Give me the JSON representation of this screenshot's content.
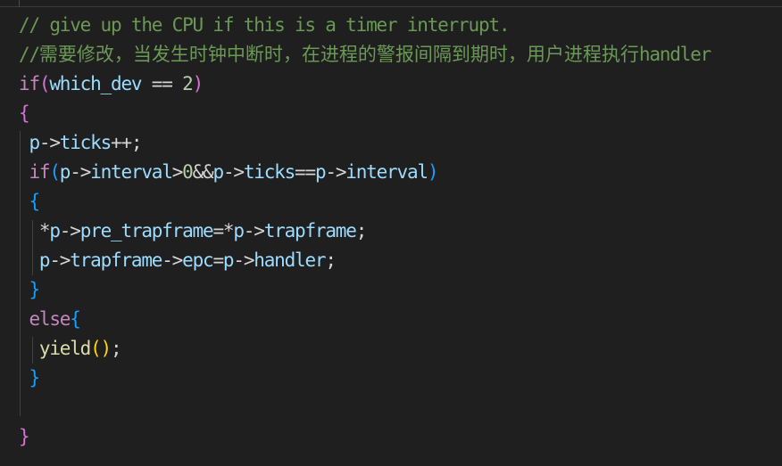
{
  "editor": {
    "language": "c",
    "theme": {
      "background": "#1f1f1f",
      "comment": "#6a9955",
      "keyword": "#c586c0",
      "identifier": "#9cdcfe",
      "operator": "#d4d4d4",
      "number": "#b5cea8",
      "function": "#dcdcaa",
      "bracket_level_1": "#da70d6",
      "bracket_level_2": "#179fff",
      "bracket_level_3": "#ffd700"
    },
    "lines": [
      {
        "tokens": [
          {
            "t": "// give up the CPU if this is a timer interrupt.",
            "k": "comment"
          }
        ]
      },
      {
        "tokens": [
          {
            "t": "//",
            "k": "comment"
          },
          {
            "t": "需要修改，当发生时钟中断时，在进程的警报间隔到期时，用户进程执行",
            "k": "comment-cjk"
          },
          {
            "t": "handler",
            "k": "comment"
          }
        ]
      },
      {
        "tokens": [
          {
            "t": "if",
            "k": "keyword"
          },
          {
            "t": "(",
            "k": "b1"
          },
          {
            "t": "which_dev",
            "k": "ident"
          },
          {
            "t": " == ",
            "k": "op"
          },
          {
            "t": "2",
            "k": "num"
          },
          {
            "t": ")",
            "k": "b1"
          }
        ]
      },
      {
        "tokens": [
          {
            "t": "{",
            "k": "b1"
          }
        ]
      },
      {
        "tokens": [
          {
            "t": " ",
            "k": "op"
          },
          {
            "t": "p",
            "k": "ident"
          },
          {
            "t": "->",
            "k": "op"
          },
          {
            "t": "ticks",
            "k": "ident"
          },
          {
            "t": "++;",
            "k": "op"
          }
        ]
      },
      {
        "tokens": [
          {
            "t": " ",
            "k": "op"
          },
          {
            "t": "if",
            "k": "keyword"
          },
          {
            "t": "(",
            "k": "b2"
          },
          {
            "t": "p",
            "k": "ident"
          },
          {
            "t": "->",
            "k": "op"
          },
          {
            "t": "interval",
            "k": "ident"
          },
          {
            "t": ">",
            "k": "op"
          },
          {
            "t": "0",
            "k": "num"
          },
          {
            "t": "&&",
            "k": "op"
          },
          {
            "t": "p",
            "k": "ident"
          },
          {
            "t": "->",
            "k": "op"
          },
          {
            "t": "ticks",
            "k": "ident"
          },
          {
            "t": "==",
            "k": "op"
          },
          {
            "t": "p",
            "k": "ident"
          },
          {
            "t": "->",
            "k": "op"
          },
          {
            "t": "interval",
            "k": "ident"
          },
          {
            "t": ")",
            "k": "b2"
          }
        ]
      },
      {
        "tokens": [
          {
            "t": " ",
            "k": "op"
          },
          {
            "t": "{",
            "k": "b2"
          }
        ]
      },
      {
        "tokens": [
          {
            "t": "  ",
            "k": "op"
          },
          {
            "t": "*",
            "k": "op"
          },
          {
            "t": "p",
            "k": "ident"
          },
          {
            "t": "->",
            "k": "op"
          },
          {
            "t": "pre_trapframe",
            "k": "ident"
          },
          {
            "t": "=*",
            "k": "op"
          },
          {
            "t": "p",
            "k": "ident"
          },
          {
            "t": "->",
            "k": "op"
          },
          {
            "t": "trapframe",
            "k": "ident"
          },
          {
            "t": ";",
            "k": "op"
          }
        ]
      },
      {
        "tokens": [
          {
            "t": "  ",
            "k": "op"
          },
          {
            "t": "p",
            "k": "ident"
          },
          {
            "t": "->",
            "k": "op"
          },
          {
            "t": "trapframe",
            "k": "ident"
          },
          {
            "t": "->",
            "k": "op"
          },
          {
            "t": "epc",
            "k": "ident"
          },
          {
            "t": "=",
            "k": "op"
          },
          {
            "t": "p",
            "k": "ident"
          },
          {
            "t": "->",
            "k": "op"
          },
          {
            "t": "handler",
            "k": "ident"
          },
          {
            "t": ";",
            "k": "op"
          }
        ]
      },
      {
        "tokens": [
          {
            "t": " ",
            "k": "op"
          },
          {
            "t": "}",
            "k": "b2"
          }
        ]
      },
      {
        "tokens": [
          {
            "t": " ",
            "k": "op"
          },
          {
            "t": "else",
            "k": "keyword"
          },
          {
            "t": "{",
            "k": "b2"
          }
        ]
      },
      {
        "tokens": [
          {
            "t": "  ",
            "k": "op"
          },
          {
            "t": "yield",
            "k": "func"
          },
          {
            "t": "()",
            "k": "b3"
          },
          {
            "t": ";",
            "k": "op"
          }
        ]
      },
      {
        "tokens": [
          {
            "t": " ",
            "k": "op"
          },
          {
            "t": "}",
            "k": "b2"
          }
        ]
      },
      {
        "tokens": []
      },
      {
        "tokens": [
          {
            "t": "}",
            "k": "b1"
          }
        ]
      }
    ]
  }
}
